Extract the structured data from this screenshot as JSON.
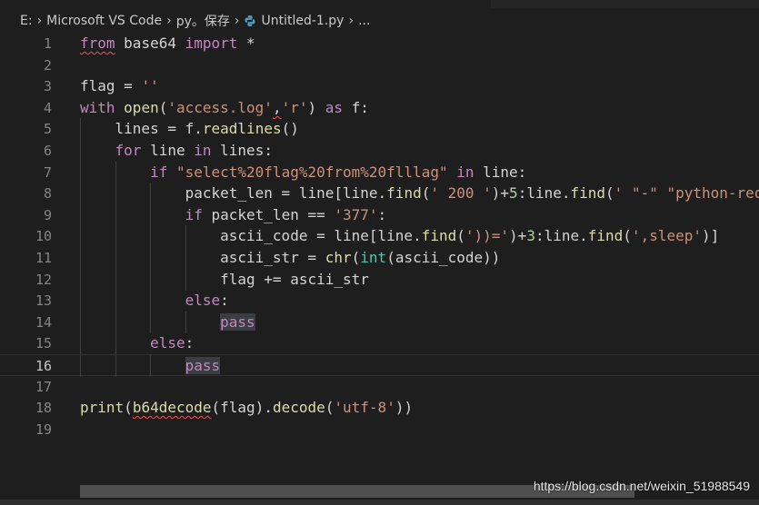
{
  "breadcrumb": {
    "drive": "E:",
    "folder1": "Microsoft VS Code",
    "folder2": "py。保存",
    "file": "Untitled-1.py",
    "more": "..."
  },
  "icons": {
    "separator": "chevron-right-icon",
    "file_type": "python-file-icon"
  },
  "editor": {
    "current_line": 16,
    "lines": [
      {
        "num": "1",
        "code": "from base64 import *"
      },
      {
        "num": "2",
        "code": ""
      },
      {
        "num": "3",
        "code": "flag = ''"
      },
      {
        "num": "4",
        "code": "with open('access.log','r') as f:"
      },
      {
        "num": "5",
        "code": "    lines = f.readlines()"
      },
      {
        "num": "6",
        "code": "    for line in lines:"
      },
      {
        "num": "7",
        "code": "        if \"select%20flag%20from%20flllag\" in line:"
      },
      {
        "num": "8",
        "code": "            packet_len = line[line.find(' 200 ')+5:line.find(' \"-\" \"python-req"
      },
      {
        "num": "9",
        "code": "            if packet_len == '377':"
      },
      {
        "num": "10",
        "code": "                ascii_code = line[line.find('))=')+3:line.find(',sleep')]"
      },
      {
        "num": "11",
        "code": "                ascii_str = chr(int(ascii_code))"
      },
      {
        "num": "12",
        "code": "                flag += ascii_str"
      },
      {
        "num": "13",
        "code": "            else:"
      },
      {
        "num": "14",
        "code": "                pass"
      },
      {
        "num": "15",
        "code": "        else:"
      },
      {
        "num": "16",
        "code": "            pass"
      },
      {
        "num": "17",
        "code": ""
      },
      {
        "num": "18",
        "code": "print(b64decode(flag).decode('utf-8'))"
      },
      {
        "num": "19",
        "code": ""
      }
    ]
  },
  "watermark": "https://blog.csdn.net/weixin_51988549",
  "colors": {
    "background": "#1e1e1e",
    "keyword_control": "#c586c0",
    "keyword": "#569cd6",
    "string": "#ce9178",
    "function": "#dcdcaa",
    "builtin_type": "#4ec9b0",
    "number": "#b5cea8",
    "identifier": "#d4d4d4",
    "line_number": "#858585",
    "error_squiggle": "#f14c4c"
  }
}
